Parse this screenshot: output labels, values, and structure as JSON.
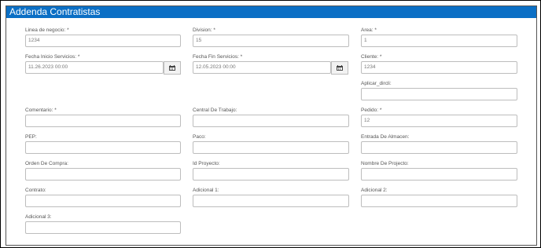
{
  "form": {
    "title": "Addenda Contratistas",
    "fields": {
      "linea_negocio": {
        "label": "Linea de negocio: *",
        "value": "1234"
      },
      "division": {
        "label": "Division: *",
        "value": "15"
      },
      "area": {
        "label": "Area: *",
        "value": "1"
      },
      "fecha_inicio": {
        "label": "Fecha Inicio Servicios: *",
        "value": "11.26.2023 00:00"
      },
      "fecha_fin": {
        "label": "Fecha Fin Servicios: *",
        "value": "12.05.2023 00:00"
      },
      "cliente": {
        "label": "Cliente: *",
        "value": "1234"
      },
      "aplicar_dircli": {
        "label": "Aplicar_dircli:",
        "value": ""
      },
      "comentario": {
        "label": "Comentario: *",
        "value": ""
      },
      "central_trabajo": {
        "label": "Central De Trabajo:",
        "value": ""
      },
      "pedido": {
        "label": "Pedido: *",
        "value": "12"
      },
      "pep": {
        "label": "PEP:",
        "value": ""
      },
      "paco": {
        "label": "Paco:",
        "value": ""
      },
      "entrada_almacen": {
        "label": "Entrada De Almacen:",
        "value": ""
      },
      "orden_compra": {
        "label": "Orden De Compra:",
        "value": ""
      },
      "id_proyecto": {
        "label": "Id Proyecto:",
        "value": ""
      },
      "nombre_proyecto": {
        "label": "Nombre De Projecto:",
        "value": ""
      },
      "contrato": {
        "label": "Contrato:",
        "value": ""
      },
      "adicional_1": {
        "label": "Adicional 1:",
        "value": ""
      },
      "adicional_2": {
        "label": "Adicional 2:",
        "value": ""
      },
      "adicional_3": {
        "label": "Adicional 3:",
        "value": ""
      }
    }
  }
}
